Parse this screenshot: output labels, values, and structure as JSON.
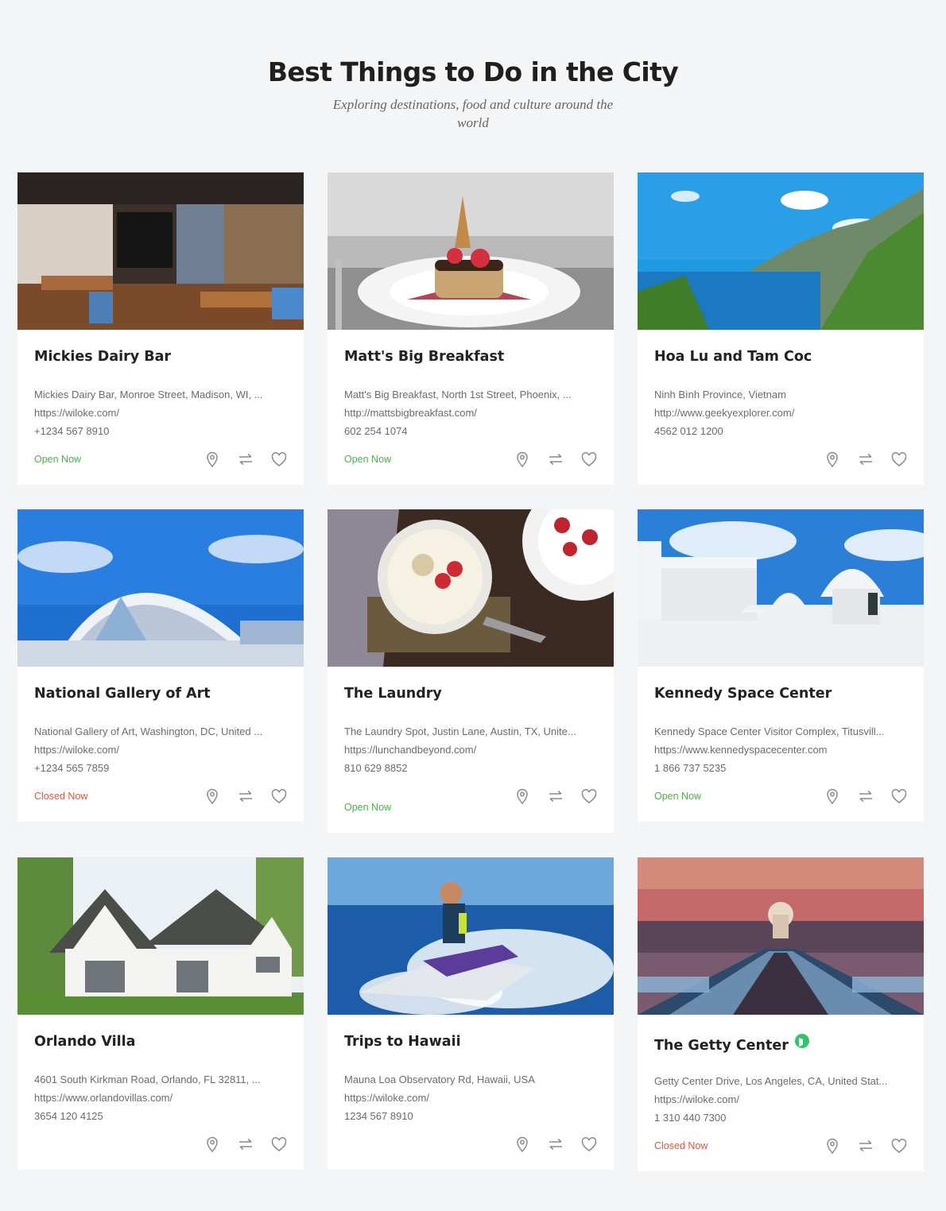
{
  "header": {
    "title": "Best Things to Do in the City",
    "subtitle": "Exploring destinations, food and culture around the world"
  },
  "colors": {
    "open": "#4fae4f",
    "closed": "#e5533a",
    "verified": "#34c26b"
  },
  "icons": {
    "location": "map-pin-icon",
    "compare": "compare-arrows-icon",
    "favorite": "heart-icon",
    "verified": "verified-badge-icon"
  },
  "listings": [
    {
      "title": "Mickies Dairy Bar",
      "address": "Mickies Dairy Bar, Monroe Street, Madison, WI, ...",
      "website": "https://wiloke.com/",
      "phone": "+1234 567 8910",
      "status": "Open Now"
    },
    {
      "title": "Matt's Big Breakfast",
      "address": "Matt's Big Breakfast, North 1st Street, Phoenix, ...",
      "website": "http://mattsbigbreakfast.com/",
      "phone": "602 254 1074",
      "status": "Open Now"
    },
    {
      "title": "Hoa Lu and Tam Coc",
      "address": "Ninh Bình Province, Vietnam",
      "website": "http://www.geekyexplorer.com/",
      "phone": "4562 012 1200",
      "status": ""
    },
    {
      "title": "National Gallery of Art",
      "address": "National Gallery of Art, Washington, DC, United ...",
      "website": "https://wiloke.com/",
      "phone": "+1234 565 7859",
      "status": "Closed Now"
    },
    {
      "title": "The Laundry",
      "address": "The Laundry Spot, Justin Lane, Austin, TX, Unite...",
      "website": "https://lunchandbeyond.com/",
      "phone": "810 629 8852",
      "status": "Open Now"
    },
    {
      "title": "Kennedy Space Center",
      "address": "Kennedy Space Center Visitor Complex, Titusvill...",
      "website": "https://www.kennedyspacecenter.com",
      "phone": "1 866 737 5235",
      "status": "Open Now"
    },
    {
      "title": "Orlando Villa",
      "address": "4601 South Kirkman Road, Orlando, FL 32811, ...",
      "website": "https://www.orlandovillas.com/",
      "phone": "3654 120 4125",
      "status": ""
    },
    {
      "title": "Trips to Hawaii",
      "address": "Mauna Loa Observatory Rd, Hawaii, USA",
      "website": "https://wiloke.com/",
      "phone": "1234 567 8910",
      "status": ""
    },
    {
      "title": "The Getty Center",
      "address": "Getty Center Drive, Los Angeles, CA, United Stat...",
      "website": "https://wiloke.com/",
      "phone": "1 310 440 7300",
      "status": "Closed Now"
    }
  ]
}
